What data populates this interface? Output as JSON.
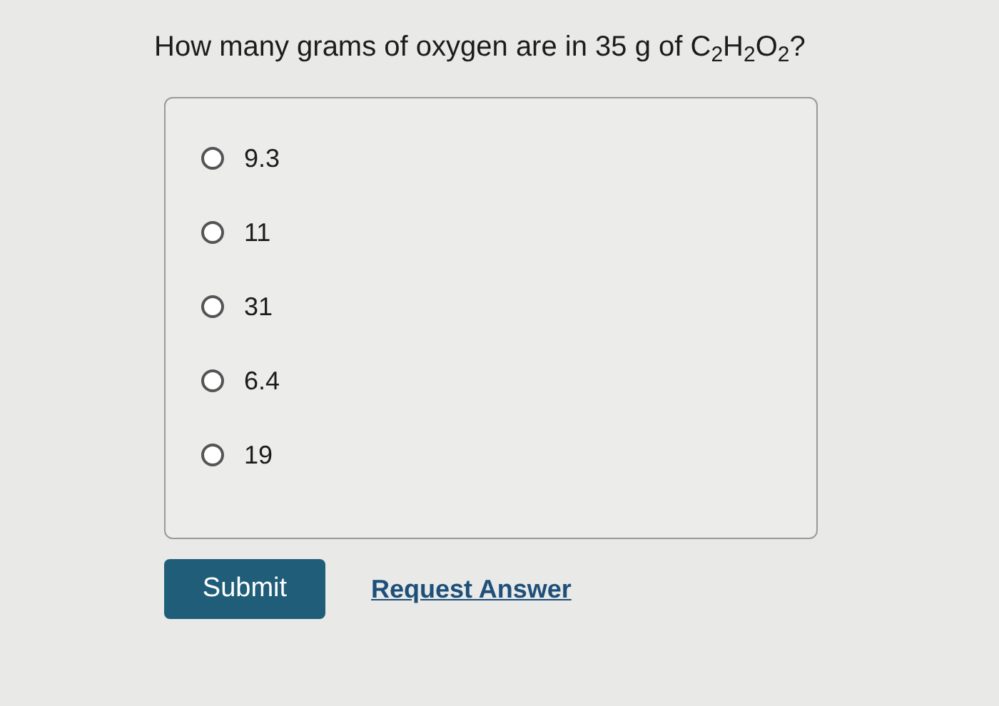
{
  "question": "How many grams of oxygen are in 35 g of C$_{2}$H$_{2}$O$_{2}$?",
  "options": [
    {
      "label": "9.3",
      "selected": false
    },
    {
      "label": "11",
      "selected": false
    },
    {
      "label": "31",
      "selected": false
    },
    {
      "label": "6.4",
      "selected": false
    },
    {
      "label": "19",
      "selected": false
    }
  ],
  "submit": "Submit",
  "request_answer": "Request Answer"
}
